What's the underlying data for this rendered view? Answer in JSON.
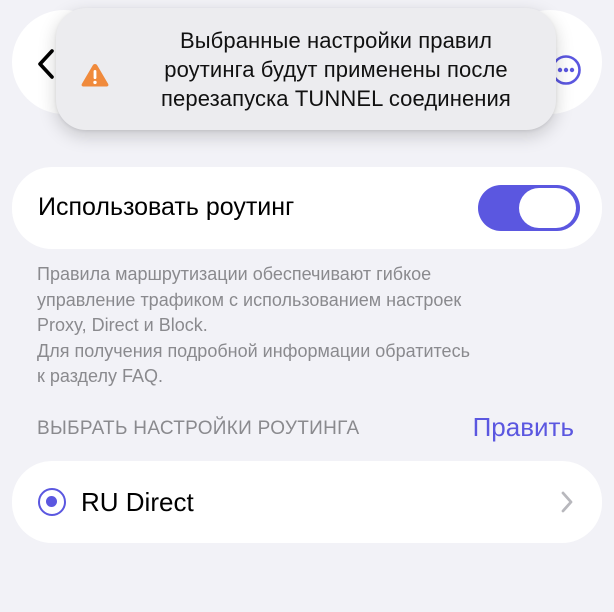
{
  "nav": {
    "back_icon": "chevron-left-icon",
    "more_icon": "ellipsis-circle-icon"
  },
  "toast": {
    "icon": "warning-triangle-icon",
    "message": "Выбранные настройки правил\nроутинга будут применены после\nперезапуска TUNNEL соединения"
  },
  "routing": {
    "label": "Использовать роутинг",
    "enabled": true,
    "description": "Правила маршрутизации обеспечивают гибкое\nуправление трафиком с использованием настроек\nProxy, Direct и Block.\nДля получения подробной информации обратитесь\nк разделу FAQ."
  },
  "section": {
    "header": "ВЫБРАТЬ НАСТРОЙКИ РОУТИНГА",
    "edit_label": "Править"
  },
  "items": [
    {
      "label": "RU Direct",
      "selected": true
    }
  ],
  "colors": {
    "accent": "#5b57e0",
    "warning": "#f08a3c",
    "background": "#f2f2f7",
    "secondary_text": "#8a8a8e"
  }
}
